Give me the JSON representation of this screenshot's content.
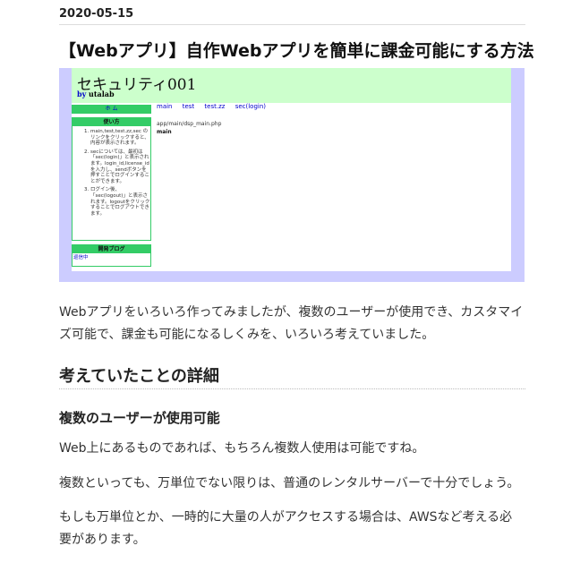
{
  "post": {
    "date": "2020-05-15",
    "title": "【Webアプリ】自作Webアプリを簡単に課金可能にする方法"
  },
  "screenshot": {
    "app_title": "セキュリティ001",
    "by": "by",
    "author": "utalab",
    "nav_label": "ホ ム",
    "usage_header": "使い方",
    "usage_items": [
      "main,test,test.zz,sec のリンクをクリックすると、内容が表示されます。",
      "secについては、最初は「sec(login)」と表示されます。login_id,license_idを入力し、sendボタンを押すことでログインすることができます。",
      "ログイン後、「sec(logout)」と表示されます。logoutをクリックすることでログアウトできます。"
    ],
    "blog_header": "開発ブログ",
    "blog_link": "巡信中",
    "menu": [
      "main",
      "test",
      "test.zz",
      "sec(login)"
    ],
    "path": "app/main/dsp_main.php",
    "main_label": "main"
  },
  "content": {
    "intro": "Webアプリをいろいろ作ってみましたが、複数のユーザーが使用でき、カスタマイズ可能で、課金も可能になるしくみを、いろいろ考えていました。",
    "h2": "考えていたことの詳細",
    "h3": "複数のユーザーが使用可能",
    "p1": "Web上にあるものであれば、もちろん複数人使用は可能ですね。",
    "p2": "複数といっても、万単位でない限りは、普通のレンタルサーバーで十分でしょう。",
    "p3": "もしも万単位とか、一時的に大量の人がアクセスする場合は、AWSなど考える必要があります。"
  }
}
